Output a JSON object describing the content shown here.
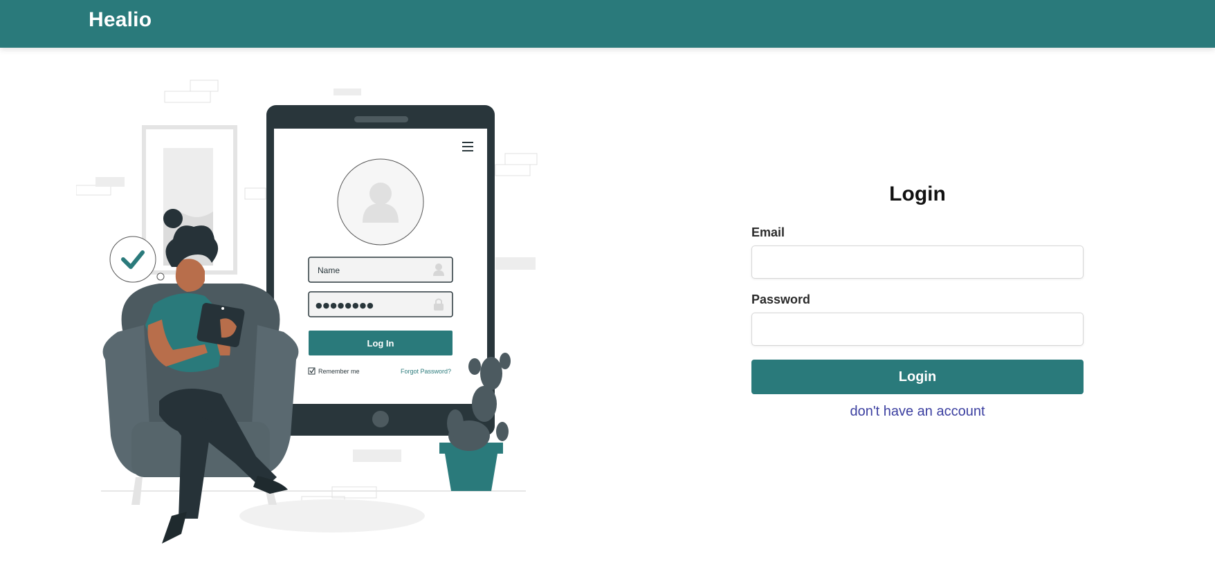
{
  "navbar": {
    "brand": "Healio",
    "color": "#2a7a7b"
  },
  "illustration": {
    "phone": {
      "name_placeholder": "Name",
      "password_dots": "●●●●●●●●",
      "login_button": "Log In",
      "remember_me": "Remember me",
      "forgot_password": "Forgot Password?"
    },
    "icons": [
      "menu-icon",
      "user-avatar-icon",
      "checkmark-icon",
      "lock-icon",
      "cactus"
    ]
  },
  "login": {
    "title": "Login",
    "email_label": "Email",
    "email_value": "",
    "password_label": "Password",
    "password_value": "",
    "submit_label": "Login",
    "signup_link": "don't have an account",
    "accent": "#2a7a7b",
    "link_color": "#3b3fa0"
  }
}
